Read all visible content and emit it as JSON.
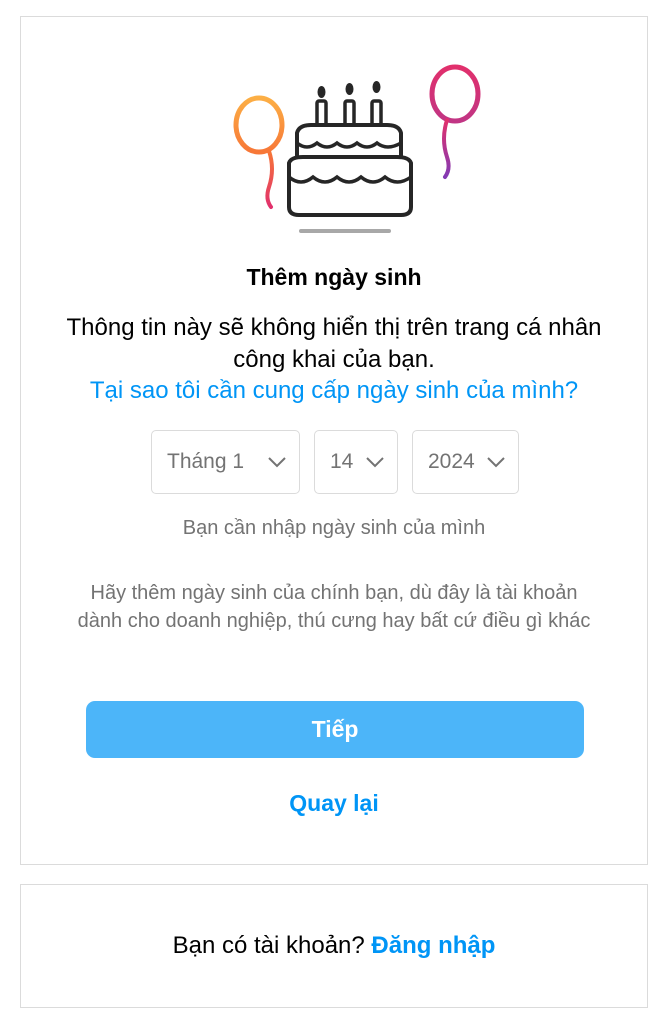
{
  "signup": {
    "illustration_icon": "birthday-cake-icon",
    "title": "Thêm ngày sinh",
    "description": "Thông tin này sẽ không hiển thị trên trang cá nhân công khai của bạn.",
    "why_link": "Tại sao tôi cần cung cấp ngày sinh của mình?",
    "month": "Tháng 1",
    "day": "14",
    "year": "2024",
    "hint": "Bạn cần nhập ngày sinh của mình",
    "note": "Hãy thêm ngày sinh của chính bạn, dù đây là tài khoản dành cho doanh nghiệp, thú cưng hay bất cứ điều gì khác",
    "next_label": "Tiếp",
    "back_label": "Quay lại"
  },
  "login": {
    "prompt": "Bạn có tài khoản?",
    "link": "Đăng nhập"
  },
  "colors": {
    "accent": "#0095f6",
    "button": "#4cb5f9",
    "muted": "#737373",
    "border": "#dbdbdb"
  }
}
